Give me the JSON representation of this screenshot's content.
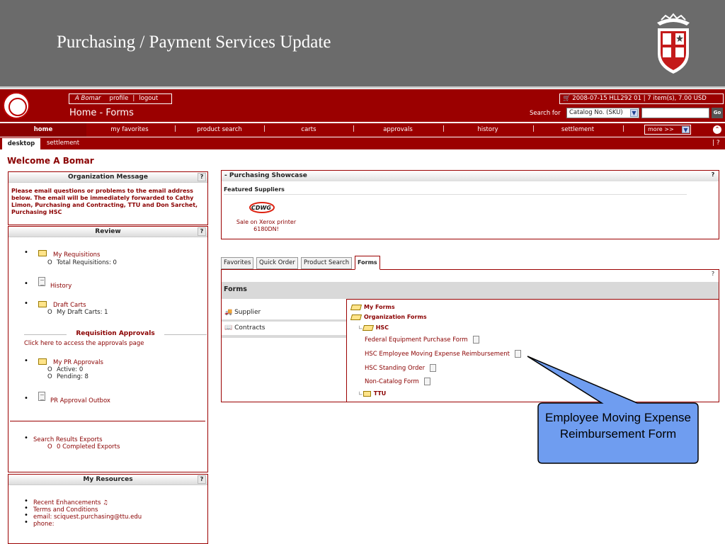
{
  "slide": {
    "title": "Purchasing / Payment Services Update"
  },
  "header": {
    "user_name": "A Bomar",
    "profile_link": "profile",
    "logout_link": "logout",
    "page_title": "Home - Forms",
    "status_text": "2008-07-15 HLL292 01 | 7 item(s), 7.00 USD",
    "search_label": "Search for",
    "search_type": "Catalog No. (SKU)",
    "search_value": "",
    "go_label": "Go"
  },
  "nav": {
    "items": [
      "home",
      "my favorites",
      "product search",
      "carts",
      "approvals",
      "history",
      "settlement"
    ],
    "more_label": "more >>",
    "separator": "|"
  },
  "subnav": {
    "tabs": [
      "desktop",
      "settlement"
    ],
    "help": "| ?"
  },
  "welcome": "Welcome A Bomar",
  "org_message": {
    "title": "Organization Message",
    "help": "?",
    "text": "Please email questions or problems to the email address below. The email will be immediately forwarded to Cathy Limon, Purchasing and Contracting, TTU and Don Sarchet, Purchasing HSC"
  },
  "review": {
    "title": "Review",
    "help": "?",
    "my_requisitions": "My Requisitions",
    "total_requisitions": "Total Requisitions: 0",
    "history": "History",
    "draft_carts": "Draft Carts",
    "my_draft_carts": "My Draft Carts: 1",
    "req_approvals_title": "Requisition Approvals",
    "approvals_link": "Click here to access the approvals page",
    "my_pr_approvals": "My PR Approvals",
    "active": "Active: 0",
    "pending": "Pending: 8",
    "pr_outbox": "PR Approval Outbox",
    "search_exports": "Search Results Exports",
    "completed_exports": "0  Completed Exports",
    "sub_bullet": "O"
  },
  "resources": {
    "title": "My Resources",
    "help": "?",
    "recent": "Recent Enhancements",
    "terms": "Terms and Conditions",
    "email": "email:  sciquest.purchasing@ttu.edu",
    "phone": "phone:"
  },
  "showcase": {
    "title": "- Purchasing Showcase",
    "help": "?",
    "featured": "Featured Suppliers",
    "logo_text": "CDWG",
    "promo": "Sale on Xerox printer 6180DN!"
  },
  "forms_tabs": [
    "Favorites",
    "Quick Order",
    "Product Search",
    "Forms"
  ],
  "forms": {
    "help": "?",
    "title": "Forms",
    "left_items": [
      "Supplier",
      "Contracts"
    ],
    "my_forms": "My Forms",
    "org_forms": "Organization Forms",
    "hsc": "HSC",
    "items": [
      "Federal Equipment Purchase Form",
      "HSC Employee Moving Expense Reimbursement",
      "HSC Standing Order",
      "Non-Catalog Form"
    ],
    "ttu": "TTU"
  },
  "callout": {
    "text": "Employee Moving Expense Reimbursement Form"
  },
  "colors": {
    "brand_red": "#9b0000",
    "slide_gray": "#6b6b6b",
    "callout_blue": "#6f9df0"
  }
}
